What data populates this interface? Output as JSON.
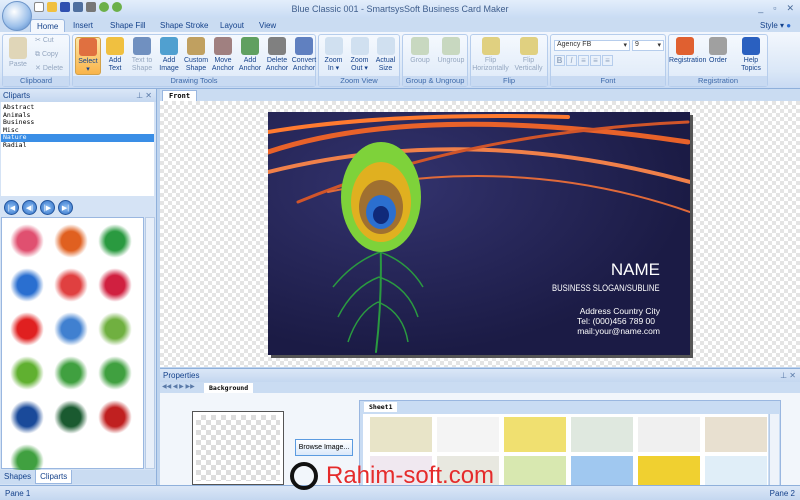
{
  "window": {
    "title": "Blue Classic 001 - SmartsysSoft Business Card Maker",
    "controls": [
      "_",
      "▫",
      "✕"
    ]
  },
  "tabs": [
    {
      "label": "Home",
      "active": true
    },
    {
      "label": "Insert"
    },
    {
      "label": "Shape Fill"
    },
    {
      "label": "Shape Stroke"
    },
    {
      "label": "Layout"
    },
    {
      "label": "View"
    }
  ],
  "style_menu": "Style",
  "ribbon": {
    "clipboard": {
      "label": "Clipboard",
      "paste": "Paste",
      "cut": "Cut",
      "copy": "Copy",
      "delete": "Delete"
    },
    "drawing": {
      "label": "Drawing Tools",
      "buttons": [
        [
          "Select",
          "▾"
        ],
        [
          "Add",
          "Text"
        ],
        [
          "Text to",
          "Shape"
        ],
        [
          "Add",
          "Image"
        ],
        [
          "Custom",
          "Shape"
        ],
        [
          "Move",
          "Anchor"
        ],
        [
          "Add",
          "Anchor"
        ],
        [
          "Delete",
          "Anchor"
        ],
        [
          "Convert",
          "Anchor"
        ]
      ]
    },
    "zoom": {
      "label": "Zoom View",
      "buttons": [
        [
          "Zoom",
          "In ▾"
        ],
        [
          "Zoom",
          "Out ▾"
        ],
        [
          "Actual",
          "Size"
        ]
      ]
    },
    "group": {
      "label": "Group & Ungroup",
      "buttons": [
        "Group",
        "Ungroup"
      ]
    },
    "flip": {
      "label": "Flip",
      "buttons": [
        [
          "Flip",
          "Horizontally"
        ],
        [
          "Flip",
          "Vertically"
        ]
      ]
    },
    "font": {
      "label": "Font",
      "family": "Agency FB",
      "size": "9",
      "styles": [
        "B",
        "I",
        "≡",
        "≡",
        "≡"
      ]
    },
    "registration": {
      "label": "Registration",
      "buttons": [
        [
          "Registration",
          ""
        ],
        [
          "Order",
          ""
        ],
        [
          "Help",
          "Topics"
        ]
      ]
    }
  },
  "cliparts": {
    "title": "Cliparts",
    "categories": [
      "Abstract",
      "Animals",
      "Business",
      "Misc",
      "Nature",
      "Radial"
    ],
    "selected": "Nature",
    "nav": [
      "|◀",
      "◀|",
      "|▶",
      "▶|"
    ]
  },
  "left_tabs": [
    "Shapes",
    "Cliparts"
  ],
  "document": {
    "tab": "Front",
    "card": {
      "name": "NAME",
      "slogan": "BUSINESS SLOGAN/SUBLINE",
      "address": "Address Country City",
      "tel": "Tel: (000)456 789 00",
      "mail": "mail:your@name.com"
    }
  },
  "properties": {
    "title": "Properties",
    "tab": "Background",
    "browse": "Browse Image...",
    "sheet_tab": "Sheet1"
  },
  "status": {
    "left": "Pane 1",
    "right": "Pane 2"
  },
  "watermark": "Rahim-soft.com"
}
